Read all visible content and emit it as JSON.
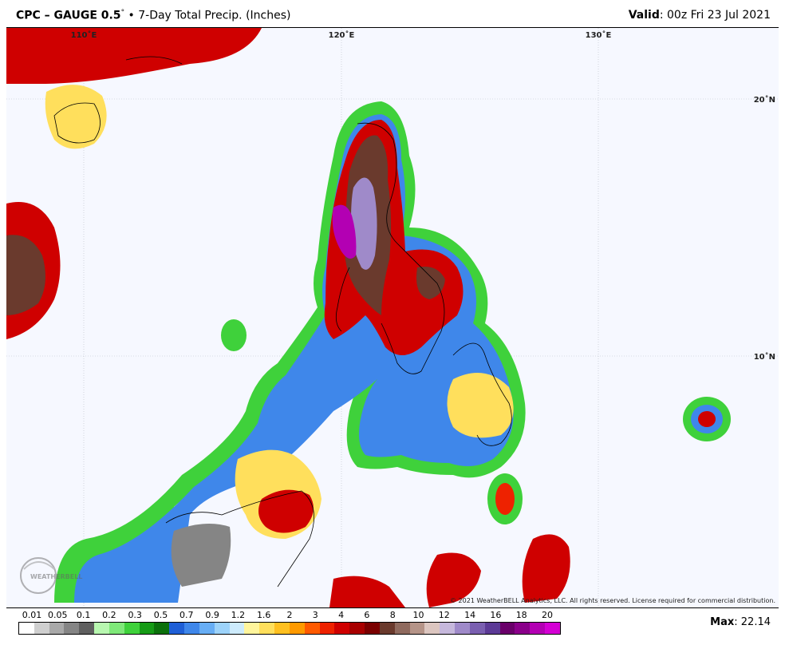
{
  "header": {
    "product": "CPC – GAUGE 0.5",
    "degree": "°",
    "subtitle": "7-Day Total Precip. (Inches)",
    "valid_label": "Valid",
    "valid_time": ": 00z Fri 23 Jul 2021"
  },
  "map": {
    "lon_labels": [
      "110˚E",
      "120˚E",
      "130˚E"
    ],
    "lat_labels": [
      "20˚N",
      "10˚N"
    ],
    "watermark": "WEATHERBELL",
    "copyright": "© 2021 WeatherBELL Analytics, LLC. All rights reserved. License required for commercial distribution."
  },
  "legend": {
    "ticks": [
      "0.01",
      "0.05",
      "0.1",
      "0.2",
      "0.3",
      "0.5",
      "0.7",
      "0.9",
      "1.2",
      "1.6",
      "2",
      "3",
      "4",
      "6",
      "8",
      "10",
      "12",
      "14",
      "16",
      "18",
      "20"
    ],
    "colors": [
      "#ffffff",
      "#cfcfcf",
      "#a9a9a9",
      "#858585",
      "#5f5f5f",
      "#b8f7b0",
      "#7fe879",
      "#3fd13b",
      "#169b16",
      "#0b700b",
      "#1f5fd6",
      "#3f87ea",
      "#68aef5",
      "#9dd3fa",
      "#cdebfc",
      "#fff59c",
      "#ffdf5c",
      "#ffc020",
      "#ff9a00",
      "#ff5a00",
      "#ee2200",
      "#cf0000",
      "#a80000",
      "#7a0000",
      "#6a3a2d",
      "#8f6a5e",
      "#b59488",
      "#dcc6c0",
      "#c6b8dc",
      "#9f8ac9",
      "#7a5fb0",
      "#5c3a96",
      "#6a006a",
      "#8a008a",
      "#b300b3",
      "#d400d4"
    ],
    "max_label": "Max",
    "max_value": ": 22.14"
  }
}
